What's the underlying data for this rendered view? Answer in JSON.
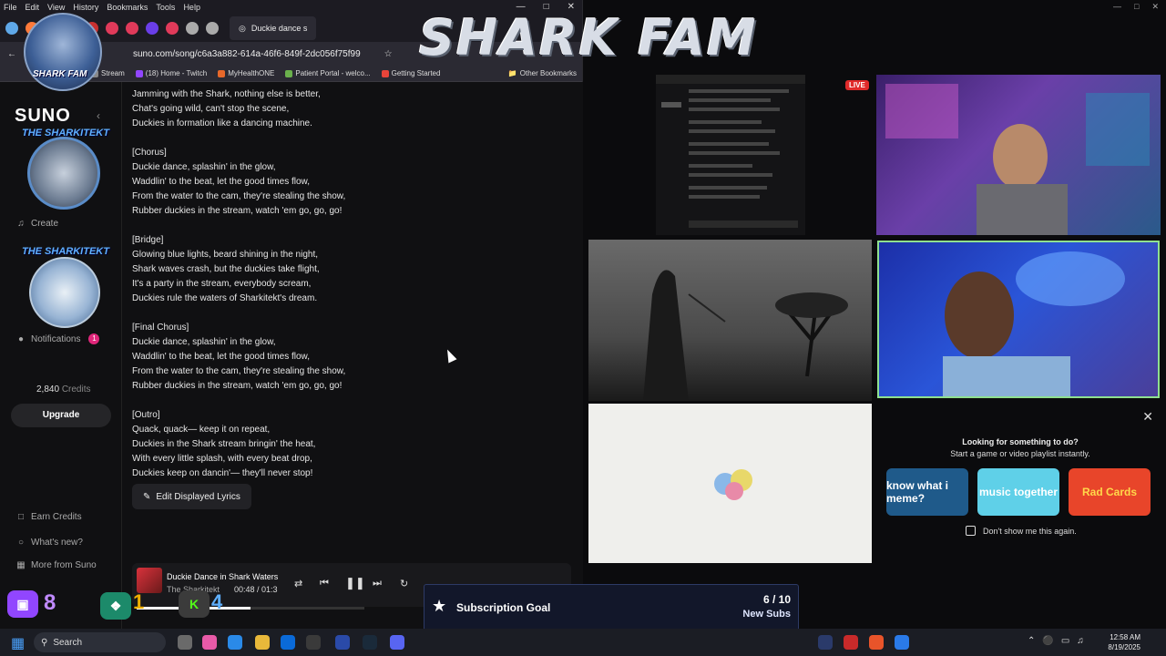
{
  "browser": {
    "menu": [
      "File",
      "Edit",
      "View",
      "History",
      "Bookmarks",
      "Tools",
      "Help"
    ],
    "active_tab_title": "Duckie dance s",
    "url": "suno.com/song/c6a3a882-614a-46f6-849f-2dc056f75f99",
    "bookmarks": [
      {
        "label": "Stream",
        "color": "#888"
      },
      {
        "label": "(18) Home - Twitch",
        "color": "#9146ff"
      },
      {
        "label": "MyHealthONE",
        "color": "#e8682a"
      },
      {
        "label": "Patient Portal - welco...",
        "color": "#6ab04c"
      },
      {
        "label": "Getting Started",
        "color": "#e8443a"
      }
    ],
    "bookmarks_other": "Other Bookmarks",
    "bookmark_first_fragment": "Im"
  },
  "suno": {
    "logo": "SUNO",
    "nav": {
      "create": "Create",
      "notifications": "Notifications",
      "notifications_count": "1"
    },
    "credits_value": "2,840",
    "credits_label": "Credits",
    "upgrade": "Upgrade",
    "footer_nav": [
      "Earn Credits",
      "What's new?",
      "More from Suno"
    ],
    "lyrics": [
      "Jamming with the Shark, nothing else is better,",
      "Chat's going wild, can't stop the scene,",
      "Duckies in formation like a dancing machine.",
      "",
      "[Chorus]",
      "Duckie dance, splashin' in the glow,",
      "Waddlin' to the beat, let the good times flow,",
      "From the water to the cam, they're stealing the show,",
      "Rubber duckies in the stream, watch 'em go, go, go!",
      "",
      "[Bridge]",
      "Glowing blue lights, beard shining in the night,",
      "Shark waves crash, but the duckies take flight,",
      "It's a party in the stream, everybody scream,",
      "Duckies rule the waters of Sharkitekt's dream.",
      "",
      "[Final Chorus]",
      "Duckie dance, splashin' in the glow,",
      "Waddlin' to the beat, let the good times flow,",
      "From the water to the cam, they're stealing the show,",
      "Rubber duckies in the stream, watch 'em go, go, go!",
      "",
      "[Outro]",
      "Quack, quack— keep it on repeat,",
      "Duckies in the Shark stream bringin' the heat,",
      "With every little splash, with every beat drop,",
      "Duckies keep on dancin'— they'll never stop!"
    ],
    "edit_lyrics": "Edit Displayed Lyrics",
    "player": {
      "title": "Duckie Dance in Shark Waters",
      "artist": "The Sharkitekt",
      "time": "00:48 / 01:3",
      "progress": 0.5
    }
  },
  "overlay": {
    "brand": "SHARK FAM",
    "logo_top_text": "SHARK FAM",
    "logo_mid_text": "THE SHARKITEKT",
    "logo_low_text": "THE SHARKITEKT",
    "twitch_count": "8",
    "kick_count": "1",
    "k4": "4"
  },
  "stream": {
    "live": "LIVE",
    "suggest": {
      "title": "Looking for something to do?",
      "subtitle": "Start a game or video playlist instantly.",
      "cards": [
        {
          "label": "know what i meme?",
          "bg": "#1f5a8a",
          "fg": "#ffffff"
        },
        {
          "label": "music together",
          "bg": "#5fd0e8",
          "fg": "#ffffff"
        },
        {
          "label": "Rad Cards",
          "bg": "#e8452a",
          "fg": "#ffd84a"
        }
      ],
      "dont_show": "Don't show me this again."
    },
    "sub_goal": {
      "title": "Subscription Goal",
      "count": "6 / 10",
      "label": "New Subs",
      "progress": 0.6
    }
  },
  "taskbar": {
    "search": "Search",
    "time": "12:58 AM",
    "date": "8/19/2025"
  },
  "colors": {
    "accent_pink": "#e0267a",
    "goal_blue": "#2358d8",
    "live_red": "#e02a2a"
  }
}
